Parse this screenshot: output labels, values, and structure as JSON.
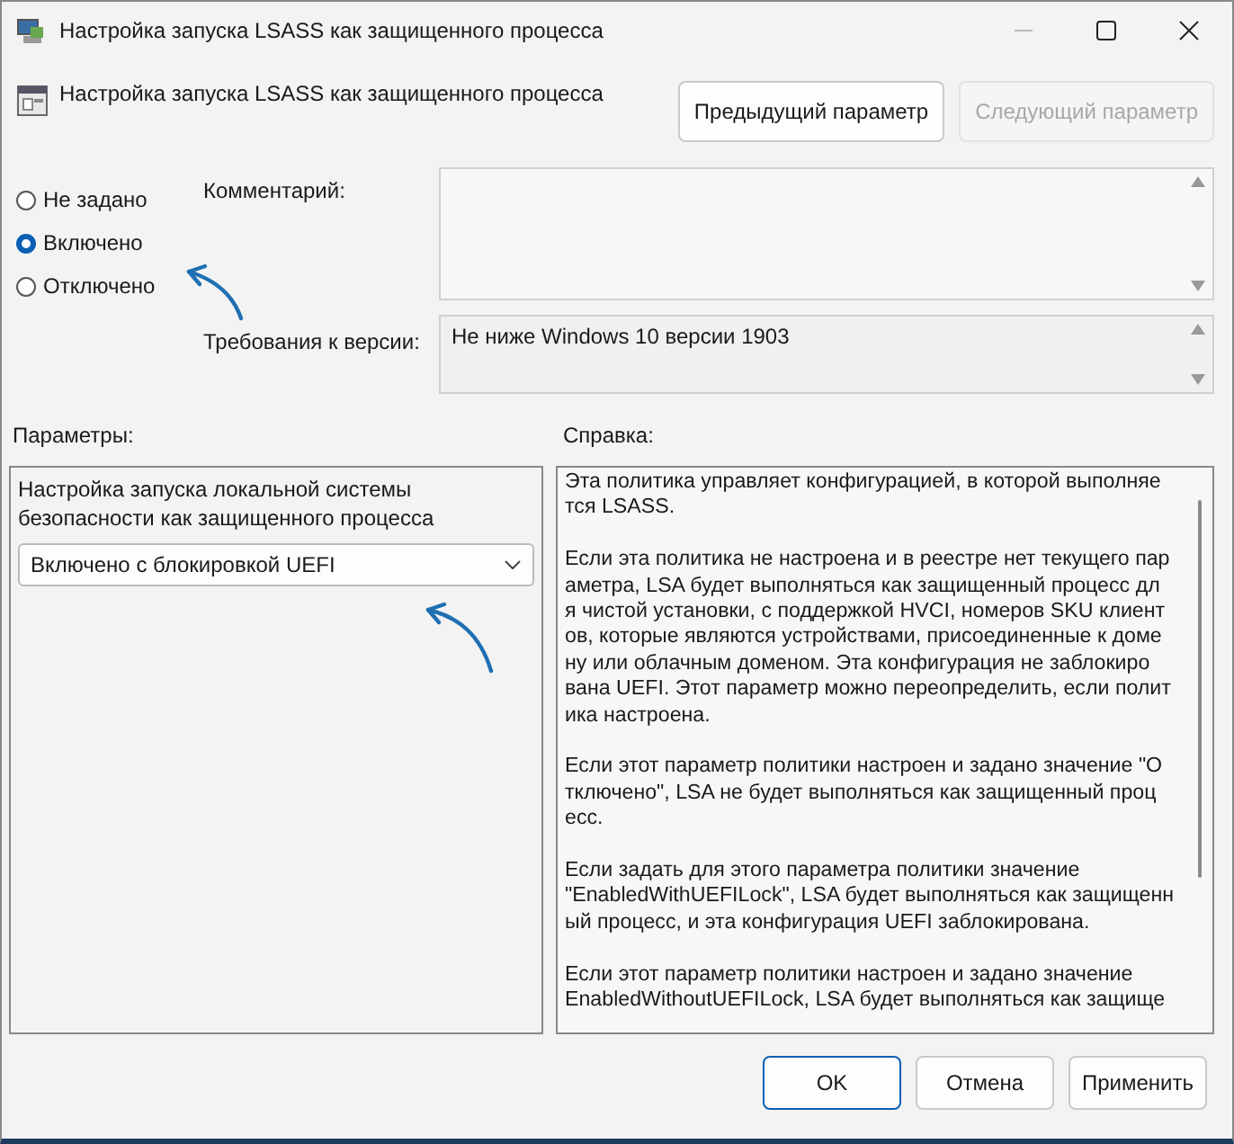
{
  "window": {
    "title": "Настройка запуска LSASS как защищенного процесса"
  },
  "header": {
    "title": "Настройка запуска LSASS как защищенного процесса",
    "buttons": [
      {
        "label": "Предыдущий параметр",
        "disabled": false
      },
      {
        "label": "Следующий параметр",
        "disabled": true
      }
    ]
  },
  "state_options": [
    {
      "label": "Не задано",
      "selected": false
    },
    {
      "label": "Включено",
      "selected": true
    },
    {
      "label": "Отключено",
      "selected": false
    }
  ],
  "comment": {
    "label": "Комментарий:"
  },
  "requirements": {
    "label": "Требования к версии:",
    "value": "Не ниже Windows 10 версии 1903"
  },
  "options_panel": {
    "label": "Параметры:",
    "description": "Настройка запуска локальной системы безопасности как защищенного процесса",
    "dropdown": {
      "value": "Включено с блокировкой UEFI"
    }
  },
  "help": {
    "label": "Справка:",
    "paragraphs": [
      [
        "Эта политика управляет конфигурацией, в которой выполняе",
        "тся LSASS."
      ],
      [
        "Если эта политика не настроена и в реестре нет текущего пар",
        "аметра, LSA будет выполняться как защищенный процесс дл",
        "я чистой установки, с поддержкой HVCI, номеров SKU клиент",
        "ов, которые являются устройствами, присоединенные к доме",
        "ну или облачным доменом. Эта конфигурация не заблокиро",
        "вана UEFI. Этот параметр можно переопределить, если полит",
        "ика настроена."
      ],
      [
        "Если этот параметр политики настроен и задано значение \"О",
        "тключено\", LSA не будет выполняться как защищенный проц",
        "есс."
      ],
      [
        "Если задать для этого параметра политики значение",
        "\"EnabledWithUEFILock\", LSA будет выполняться как защищенн",
        "ый процесс, и эта конфигурация UEFI заблокирована."
      ],
      [
        "Если этот параметр политики настроен и задано значение",
        "EnabledWithoutUEFILock, LSA будет выполняться как защище"
      ]
    ]
  },
  "buttons": [
    {
      "label": "OK",
      "default": true
    },
    {
      "label": "Отмена",
      "default": false
    },
    {
      "label": "Применить",
      "default": false
    }
  ]
}
